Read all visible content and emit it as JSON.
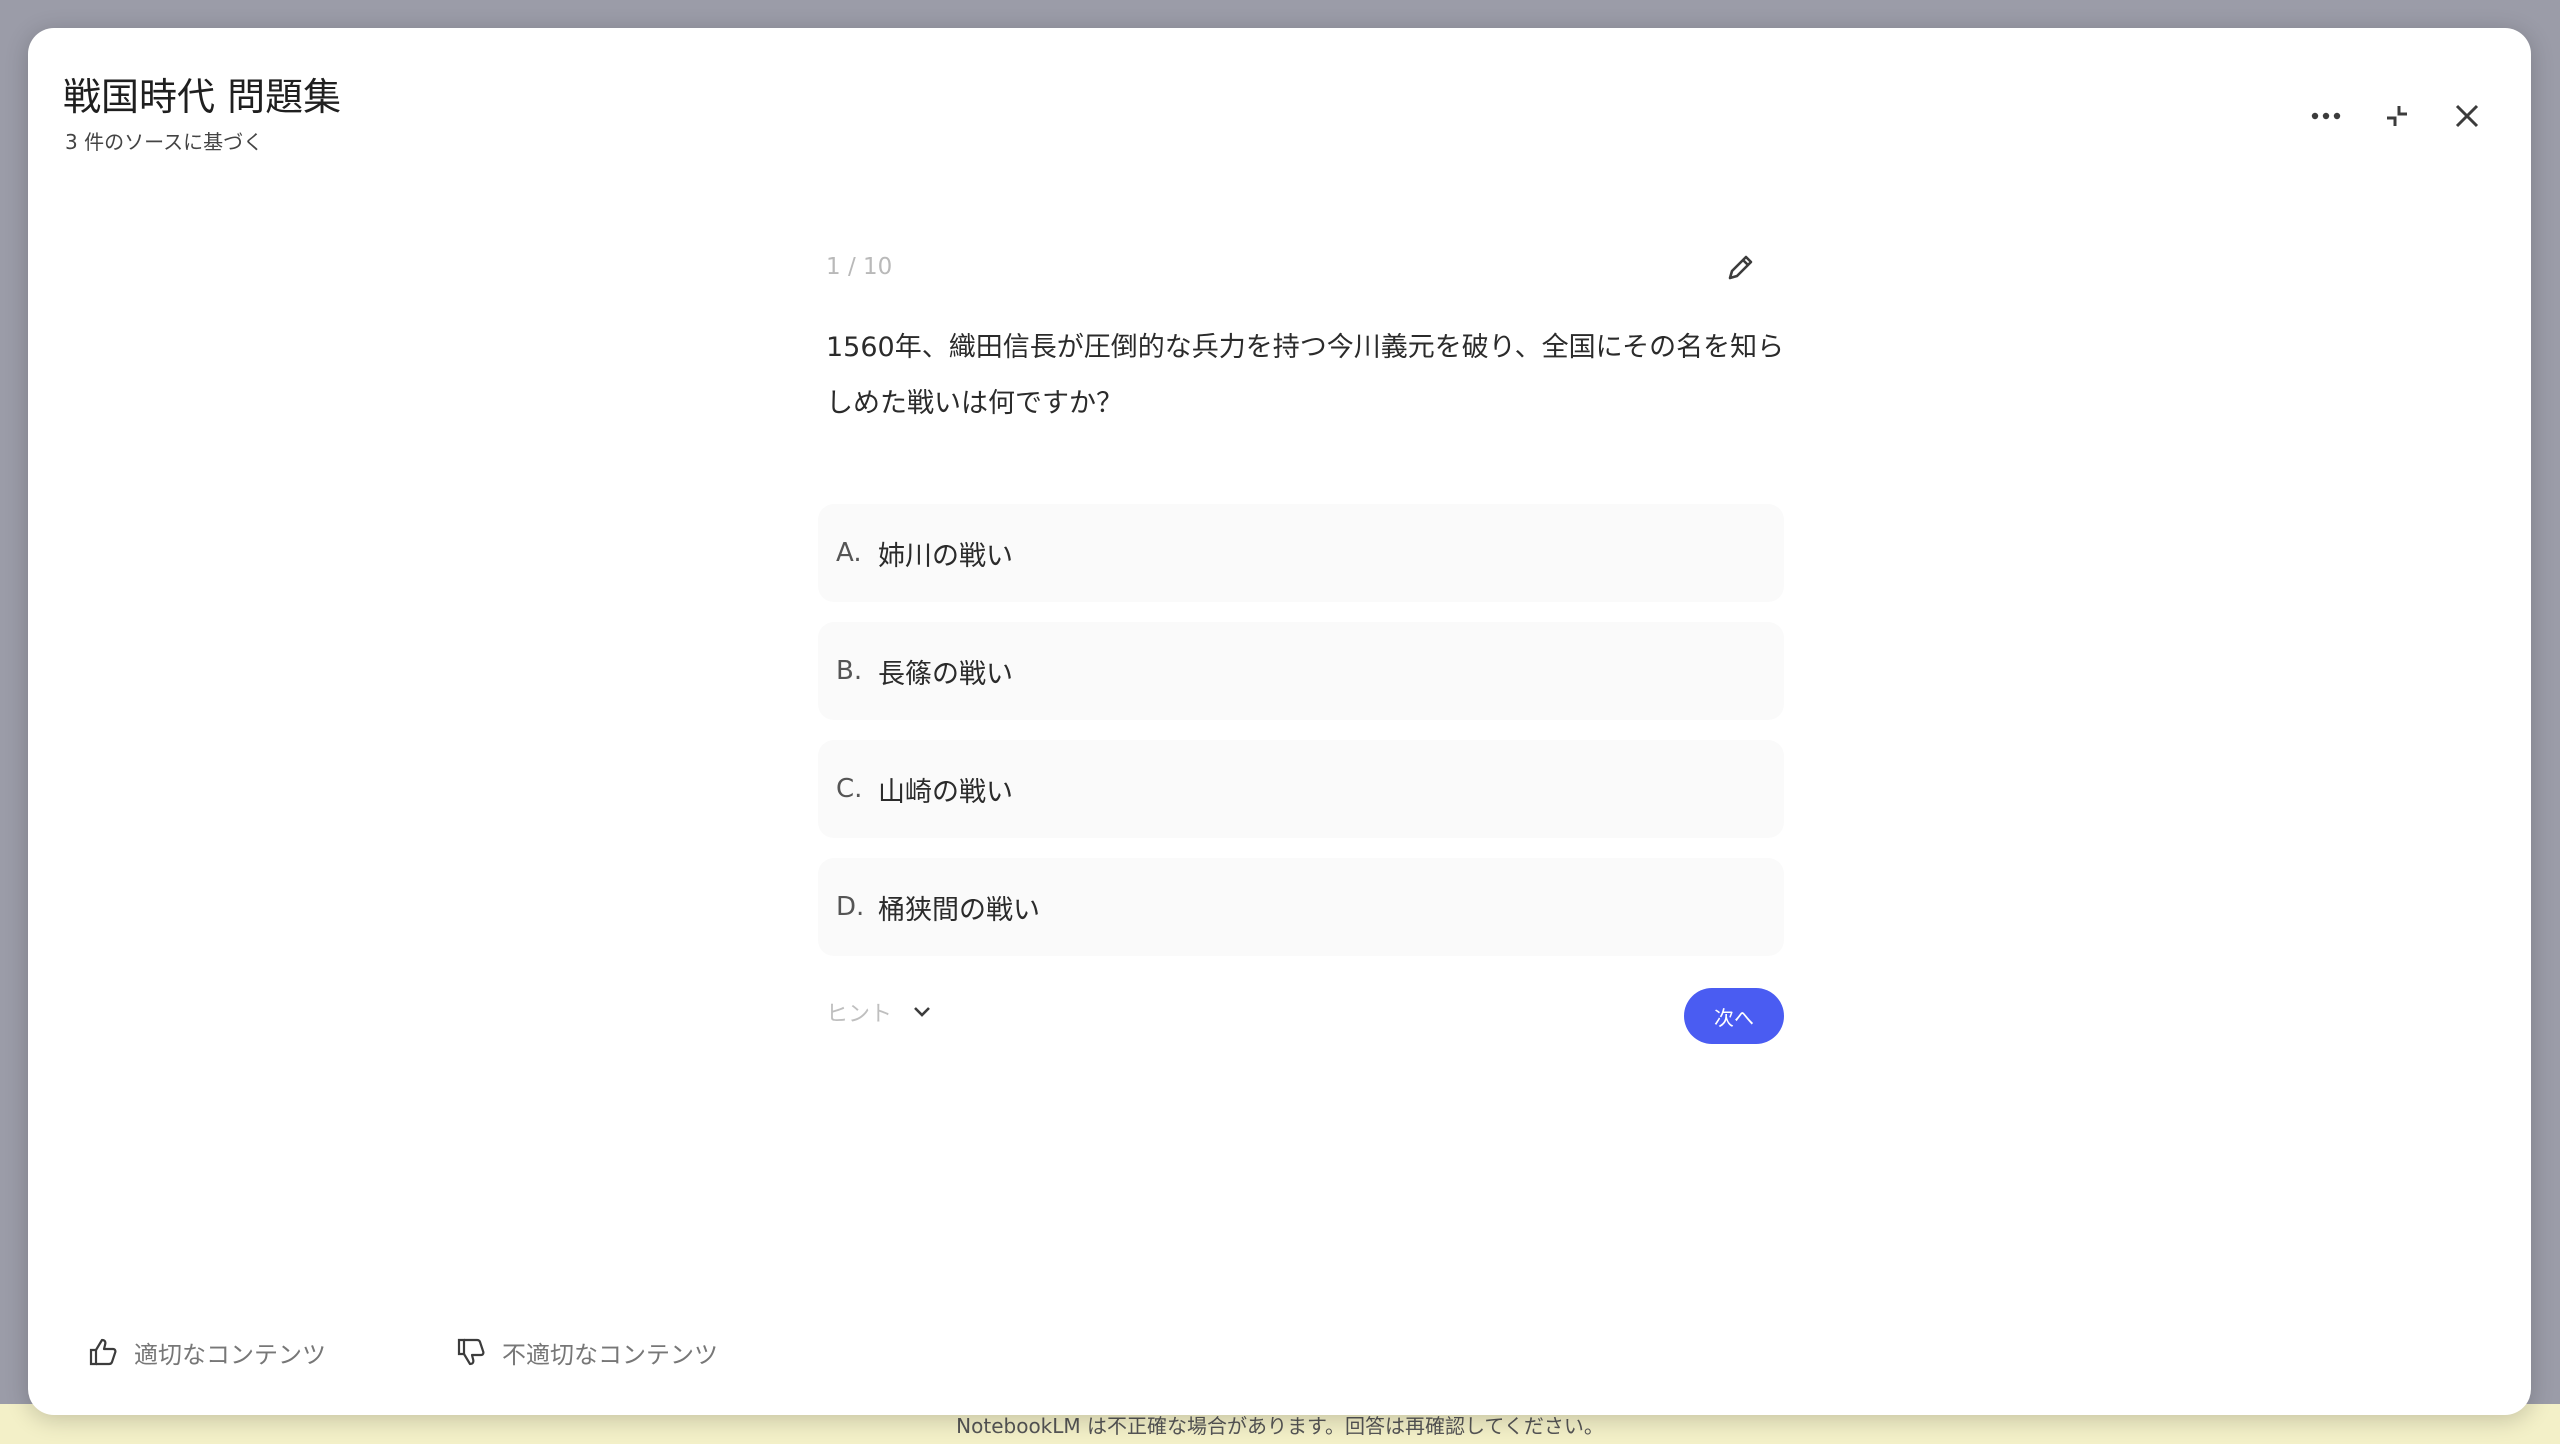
{
  "backdrop": {
    "footer_note": "NotebookLM は不正確な場合があります。回答は再確認してください。"
  },
  "header": {
    "title": "戦国時代 問題集",
    "subtitle": "3 件のソースに基づく",
    "icons": [
      "more-horizontal-icon",
      "collapse-icon",
      "close-icon"
    ]
  },
  "quiz": {
    "counter": "1 / 10",
    "question": "1560年、織田信長が圧倒的な兵力を持つ今川義元を破り、全国にその名を知らしめた戦いは何ですか？",
    "options": [
      {
        "letter": "A.",
        "text": "姉川の戦い"
      },
      {
        "letter": "B.",
        "text": "長篠の戦い"
      },
      {
        "letter": "C.",
        "text": "山崎の戦い"
      },
      {
        "letter": "D.",
        "text": "桶狭間の戦い"
      }
    ],
    "hint_label": "ヒント",
    "next_label": "次へ"
  },
  "feedback": {
    "good_label": "適切なコンテンツ",
    "bad_label": "不適切なコンテンツ"
  },
  "colors": {
    "accent": "#4a5cf2",
    "backdrop": "#9b9ca8"
  }
}
